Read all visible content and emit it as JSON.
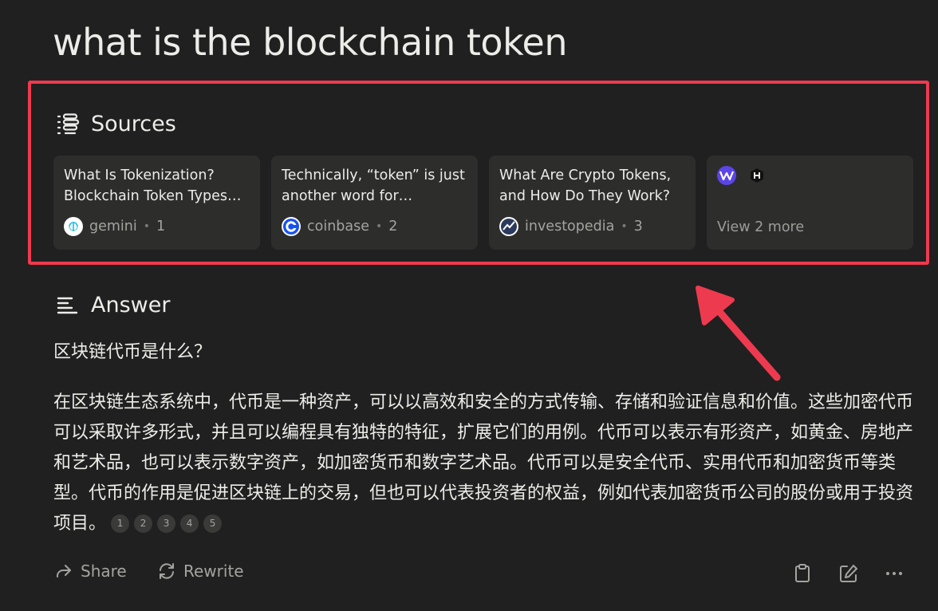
{
  "query": "what is the blockchain token",
  "sources": {
    "heading": "Sources",
    "cards": [
      {
        "title": "What Is Tokenization? Blockchain Token Types and Uses",
        "site": "gemini",
        "index": "1",
        "icon": "gemini-favicon"
      },
      {
        "title": "Technically, “token” is just another word for cryptocurrency",
        "site": "coinbase",
        "index": "2",
        "icon": "coinbase-favicon"
      },
      {
        "title": "What Are Crypto Tokens, and How Do They Work?",
        "site": "investopedia",
        "index": "3",
        "icon": "investopedia-favicon"
      }
    ],
    "more": {
      "label": "View 2 more",
      "icons": [
        "w-favicon",
        "hex-favicon"
      ]
    },
    "dot": "•"
  },
  "answer": {
    "heading": "Answer",
    "question": "区块链代币是什么？",
    "body": "在区块链生态系统中，代币是一种资产，可以以高效和安全的方式传输、存储和验证信息和价值。这些加密代币可以采取许多形式，并且可以编程具有独特的特征，扩展它们的用例。代币可以表示有形资产，如黄金、房地产和艺术品，也可以表示数字资产，如加密货币和数字艺术品。代币可以是安全代币、实用代币和加密货币等类型。代币的作用是促进区块链上的交易，但也可以代表投资者的权益，例如代表加密货币公司的股份或用于投资项目。",
    "citations": [
      "1",
      "2",
      "3",
      "4",
      "5"
    ]
  },
  "actions": {
    "share": "Share",
    "rewrite": "Rewrite",
    "icons": [
      "clipboard-icon",
      "edit-icon",
      "more-icon"
    ]
  },
  "colors": {
    "background": "#202020",
    "card": "#2d2d2c",
    "annotation_red": "#ee3a4f",
    "muted_text": "#a3a39f"
  }
}
